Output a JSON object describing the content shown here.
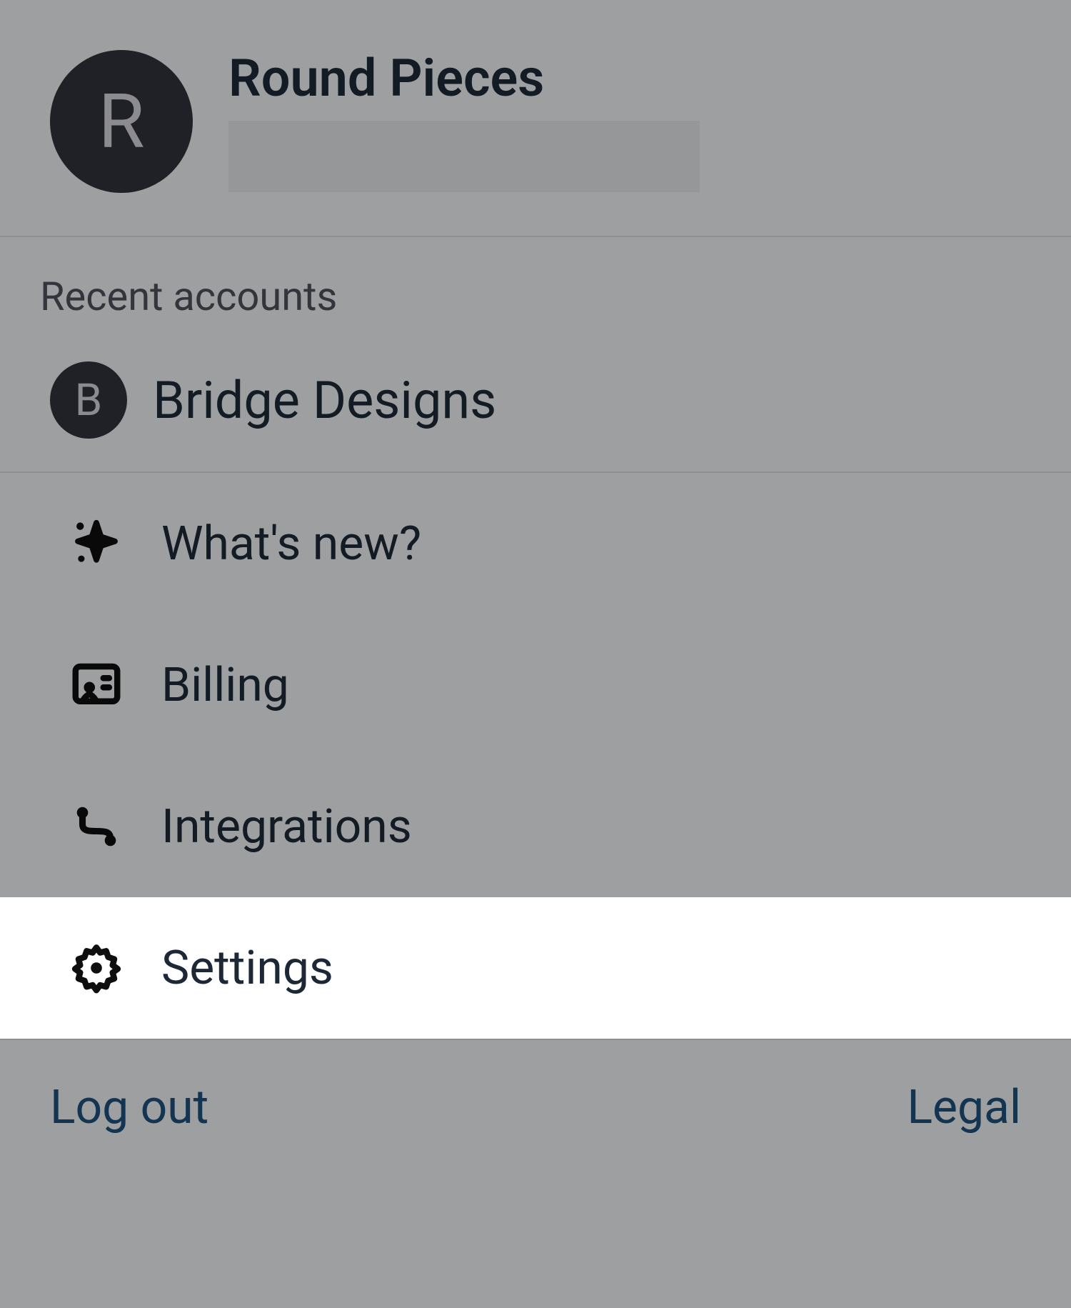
{
  "profile": {
    "avatar_letter": "R",
    "name": "Round Pieces"
  },
  "recent_accounts": {
    "label": "Recent accounts",
    "items": [
      {
        "avatar_letter": "B",
        "name": "Bridge Designs"
      }
    ]
  },
  "menu": {
    "whats_new": "What's new?",
    "billing": "Billing",
    "integrations": "Integrations",
    "settings": "Settings"
  },
  "footer": {
    "logout": "Log out",
    "legal": "Legal"
  },
  "highlighted_menu_item": "settings"
}
